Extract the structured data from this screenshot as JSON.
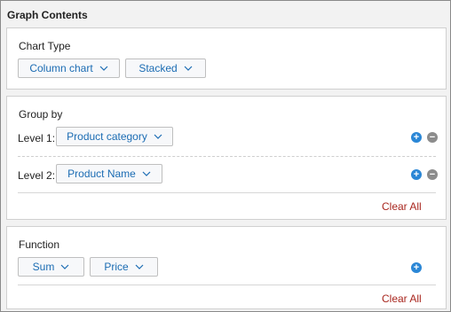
{
  "title": "Graph Contents",
  "chart_type": {
    "label": "Chart Type",
    "type_value": "Column chart",
    "mode_value": "Stacked"
  },
  "group_by": {
    "label": "Group by",
    "levels": [
      {
        "label": "Level 1:",
        "value": "Product category"
      },
      {
        "label": "Level 2:",
        "value": "Product Name"
      }
    ],
    "clear_label": "Clear All"
  },
  "function": {
    "label": "Function",
    "aggregate_value": "Sum",
    "field_value": "Price",
    "clear_label": "Clear All"
  },
  "icons": {
    "add": "plus-circle-icon",
    "remove": "minus-circle-icon",
    "dropdown": "chevron-down-icon"
  },
  "colors": {
    "link_blue": "#1b6cb3",
    "add_blue": "#2b87d6",
    "remove_gray": "#8c8c8c",
    "clear_red": "#a8261e"
  }
}
